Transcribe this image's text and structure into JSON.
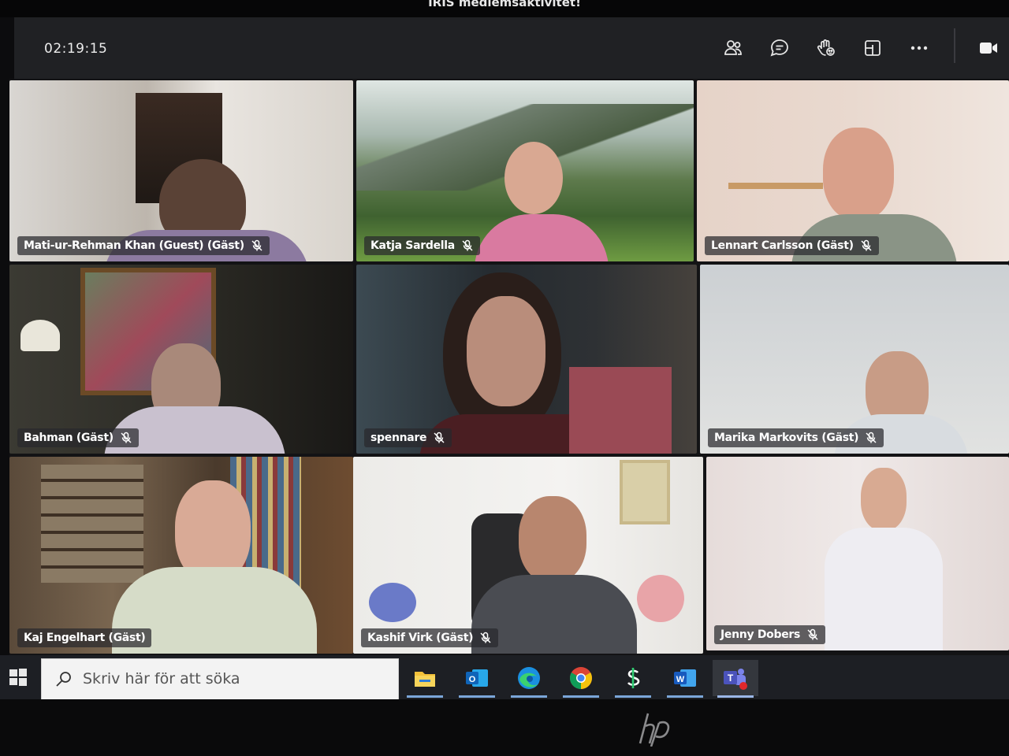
{
  "window": {
    "title": "IRIS medlemsaktivitet!"
  },
  "meeting": {
    "timer": "02:19:15",
    "toolbar": [
      {
        "icon": "people-icon",
        "label": "Deltagare"
      },
      {
        "icon": "chat-icon",
        "label": "Chatt"
      },
      {
        "icon": "raise-hand-icon",
        "label": "Räck upp handen"
      },
      {
        "icon": "rooms-icon",
        "label": "Grupprum"
      },
      {
        "icon": "more-options-icon",
        "label": "Fler åtgärder"
      },
      {
        "icon": "camera-icon",
        "label": "Kamera"
      }
    ]
  },
  "participants": [
    {
      "name": "Mati-ur-Rehman Khan (Guest) (Gäst)",
      "muted": true
    },
    {
      "name": "Katja Sardella",
      "muted": true
    },
    {
      "name": "Lennart Carlsson (Gäst)",
      "muted": true
    },
    {
      "name": "Bahman (Gäst)",
      "muted": true
    },
    {
      "name": "spennare",
      "muted": true
    },
    {
      "name": "Marika Markovits (Gäst)",
      "muted": true
    },
    {
      "name": "Kaj Engelhart (Gäst)",
      "muted": false
    },
    {
      "name": "Kashif Virk (Gäst)",
      "muted": true
    },
    {
      "name": "Jenny Dobers",
      "muted": true
    }
  ],
  "taskbar": {
    "search_placeholder": "Skriv här för att söka",
    "apps": [
      {
        "icon": "file-explorer-icon"
      },
      {
        "icon": "outlook-icon",
        "letter": "O"
      },
      {
        "icon": "edge-icon"
      },
      {
        "icon": "chrome-icon"
      },
      {
        "icon": "money-app-icon"
      },
      {
        "icon": "word-icon",
        "letter": "W"
      },
      {
        "icon": "teams-icon",
        "letter": "T"
      }
    ]
  },
  "colors": {
    "toolbar_bg": "#202124",
    "taskbar_bg": "#1d1f24",
    "accent": "#7aa6d9",
    "nametag_bg": "#28282c"
  }
}
